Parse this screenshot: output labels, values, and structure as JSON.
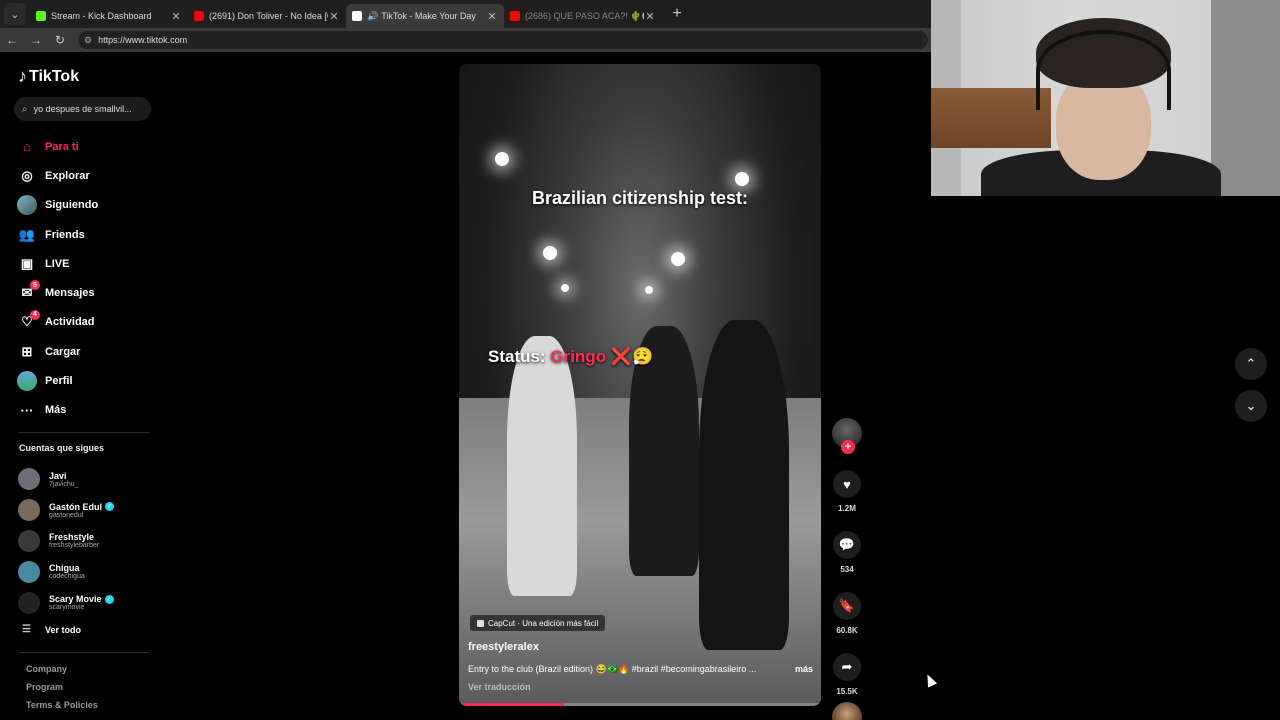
{
  "browser": {
    "tabs": [
      {
        "title": "Stream - Kick Dashboard",
        "favicon_color": "#53fc18",
        "active": false
      },
      {
        "title": "(2691) Don Toliver - No Idea [Offi",
        "favicon_color": "#ff0000",
        "active": false
      },
      {
        "title": "TikTok - Make Your Day",
        "favicon_color": "#ffffff",
        "active": true
      },
      {
        "title": "(2686) QUE PASO ACA?! 🌵😊 - Yo",
        "favicon_color": "#ff0000",
        "active": false
      }
    ],
    "url": "https://www.tiktok.com"
  },
  "sidebar": {
    "logo_text": "TikTok",
    "search_value": "yo despues de smallvil...",
    "nav": [
      {
        "label": "Para ti",
        "icon": "home-icon",
        "active": true
      },
      {
        "label": "Explorar",
        "icon": "compass-icon"
      },
      {
        "label": "Siguiendo",
        "icon": "following-avatar-icon"
      },
      {
        "label": "Friends",
        "icon": "friends-icon"
      },
      {
        "label": "LIVE",
        "icon": "live-icon"
      },
      {
        "label": "Mensajes",
        "icon": "messages-icon",
        "badge": "5"
      },
      {
        "label": "Actividad",
        "icon": "activity-icon",
        "badge": "4"
      },
      {
        "label": "Cargar",
        "icon": "upload-icon"
      },
      {
        "label": "Perfil",
        "icon": "profile-avatar-icon"
      },
      {
        "label": "Más",
        "icon": "more-icon"
      }
    ],
    "following_title": "Cuentas que sigues",
    "following": [
      {
        "name": "Javi",
        "username": "7javichu_",
        "verified": false
      },
      {
        "name": "Gastón Edul",
        "username": "gastonedul",
        "verified": true
      },
      {
        "name": "Freshstyle",
        "username": "freshstylebarber",
        "verified": false
      },
      {
        "name": "Chigua",
        "username": "codechigua",
        "verified": false
      },
      {
        "name": "Scary Movie",
        "username": "scarymovie",
        "verified": true
      }
    ],
    "see_all": "Ver todo",
    "footer": [
      "Company",
      "Program",
      "Terms & Policies"
    ]
  },
  "video": {
    "overlay_text_1": "Brazilian citizenship test:",
    "overlay_status_label": "Status:",
    "overlay_status_value": "Gringo",
    "overlay_status_emoji": "❌😮‍💨",
    "capcut_label": "CapCut · Una edición más fácil",
    "author": "freestyleralex",
    "description": "Entry to the club (Brazil edition) 😂🇧🇷🔥 #brazil #becomingabrasileiro ...",
    "more": "más",
    "translate": "Ver traducción",
    "progress": 0.29
  },
  "actions": {
    "like_count": "1.2M",
    "comment_count": "534",
    "save_count": "60.8K",
    "share_count": "15.5K"
  }
}
